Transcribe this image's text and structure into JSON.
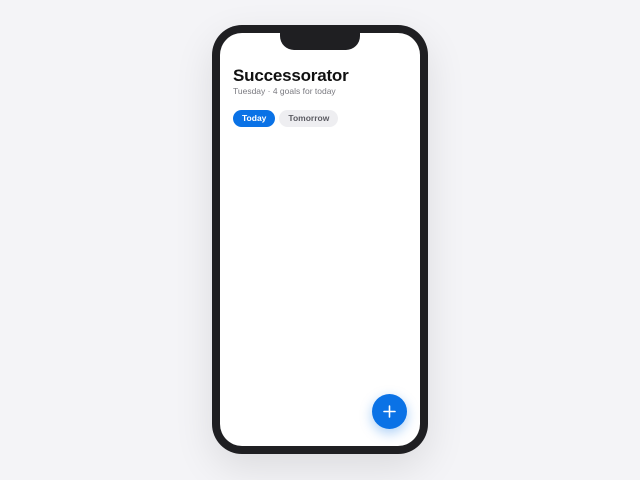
{
  "app": {
    "title": "Successorator",
    "subtitle": "Tuesday · 4 goals for today"
  },
  "tabs": [
    {
      "label": "Today",
      "active": true
    },
    {
      "label": "Tomorrow",
      "active": false
    }
  ],
  "fab": {
    "icon": "plus-icon"
  },
  "colors": {
    "accent": "#0a72e6",
    "background": "#f4f4f7",
    "phone_frame": "#1f1f22"
  }
}
